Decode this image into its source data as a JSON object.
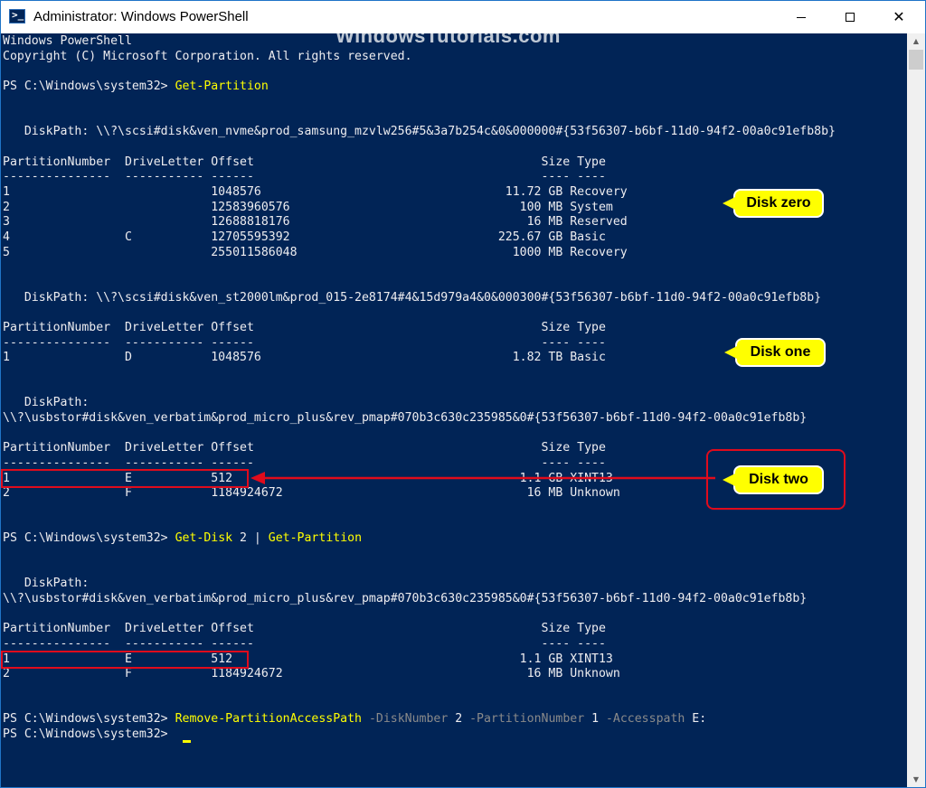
{
  "window": {
    "title": "Administrator: Windows PowerShell",
    "minimize_icon": "minimize-icon",
    "maximize_icon": "maximize-icon",
    "close_icon": "close-icon",
    "close_glyph": "✕"
  },
  "watermark": "WindowsTutorials.com",
  "console": {
    "header1": "Windows PowerShell",
    "header2": "Copyright (C) Microsoft Corporation. All rights reserved.",
    "prompt": "PS C:\\Windows\\system32> ",
    "cmd1": "Get-Partition",
    "disk0_path": "   DiskPath: \\\\?\\scsi#disk&ven_nvme&prod_samsung_mzvlw256#5&3a7b254c&0&000000#{53f56307-b6bf-11d0-94f2-00a0c91efb8b}",
    "col_header": "PartitionNumber  DriveLetter Offset                                        Size Type",
    "col_sep": "---------------  ----------- ------                                        ---- ----",
    "disk0_rows": [
      "1                            1048576                                  11.72 GB Recovery",
      "2                            12583960576                                100 MB System",
      "3                            12688818176                                 16 MB Reserved",
      "4                C           12705595392                             225.67 GB Basic",
      "5                            255011586048                              1000 MB Recovery"
    ],
    "disk1_path": "   DiskPath: \\\\?\\scsi#disk&ven_st2000lm&prod_015-2e8174#4&15d979a4&0&000300#{53f56307-b6bf-11d0-94f2-00a0c91efb8b}",
    "disk1_rows": [
      "1                D           1048576                                   1.82 TB Basic"
    ],
    "disk2_label": "   DiskPath:",
    "disk2_path": "\\\\?\\usbstor#disk&ven_verbatim&prod_micro_plus&rev_pmap#070b3c630c235985&0#{53f56307-b6bf-11d0-94f2-00a0c91efb8b}",
    "disk2_rows": [
      "1                E           512                                        1.1 GB XINT13",
      "2                F           1184924672                                  16 MB Unknown"
    ],
    "cmd2a": "Get-Disk",
    "cmd2b": " 2 | ",
    "cmd2c": "Get-Partition",
    "cmd3": "Remove-PartitionAccessPath",
    "cmd3_p1": " -DiskNumber",
    "cmd3_v1": " 2",
    "cmd3_p2": " -PartitionNumber",
    "cmd3_v2": " 1",
    "cmd3_p3": " -Accesspath",
    "cmd3_v3": " E:"
  },
  "callouts": {
    "disk_zero": "Disk zero",
    "disk_one": "Disk one",
    "disk_two": "Disk two"
  },
  "colors": {
    "console_bg": "#012456",
    "console_text": "#eeedf0",
    "command": "#ffff00",
    "parameter": "#8a8a8a",
    "callout_bg": "#ffff00",
    "highlight_red": "#e00b1c"
  }
}
